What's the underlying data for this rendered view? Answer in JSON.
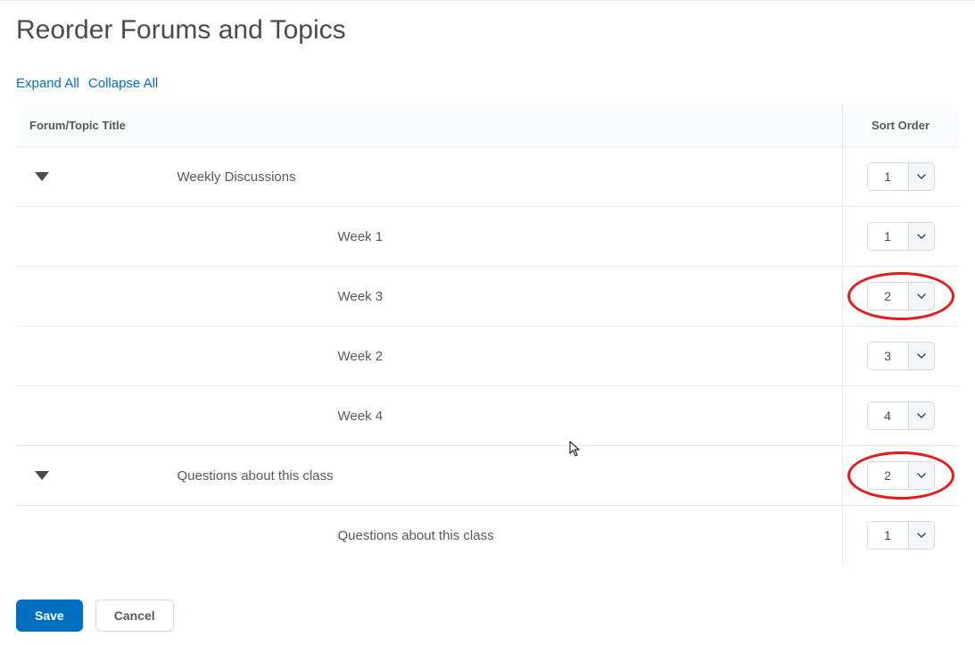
{
  "page": {
    "title": "Reorder Forums and Topics",
    "expand_label": "Expand All",
    "collapse_label": "Collapse All"
  },
  "table": {
    "header_title": "Forum/Topic Title",
    "header_sort": "Sort Order",
    "rows": [
      {
        "type": "forum",
        "title": "Weekly Discussions",
        "sort": "1",
        "highlight": false
      },
      {
        "type": "topic",
        "title": "Week 1",
        "sort": "1",
        "highlight": false
      },
      {
        "type": "topic",
        "title": "Week 3",
        "sort": "2",
        "highlight": true
      },
      {
        "type": "topic",
        "title": "Week 2",
        "sort": "3",
        "highlight": false
      },
      {
        "type": "topic",
        "title": "Week 4",
        "sort": "4",
        "highlight": false
      },
      {
        "type": "forum",
        "title": "Questions about this class",
        "sort": "2",
        "highlight": true
      },
      {
        "type": "topic",
        "title": "Questions about this class",
        "sort": "1",
        "highlight": false
      }
    ]
  },
  "buttons": {
    "save": "Save",
    "cancel": "Cancel"
  }
}
